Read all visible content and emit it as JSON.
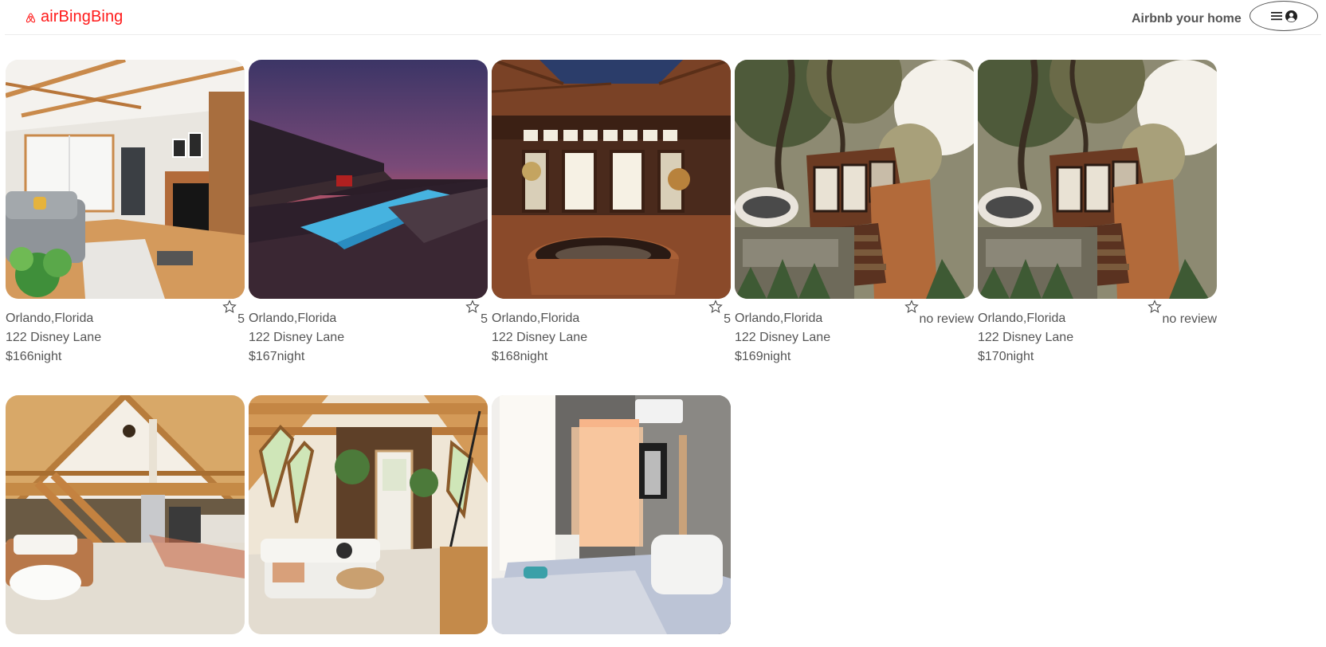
{
  "header": {
    "logo_text": "airBingBing",
    "host_link": "Airbnb your home",
    "brand_color": "#ff1a1a"
  },
  "listings": [
    {
      "location": "Orlando,Florida",
      "address": "122 Disney Lane",
      "price": "$166night",
      "rating": "5",
      "photo": "living-room-fireplace"
    },
    {
      "location": "Orlando,Florida",
      "address": "122 Disney Lane",
      "price": "$167night",
      "rating": "5",
      "photo": "infinity-pool-sunset"
    },
    {
      "location": "Orlando,Florida",
      "address": "122 Disney Lane",
      "price": "$168night",
      "rating": "5",
      "photo": "wooden-hot-tub-room"
    },
    {
      "location": "Orlando,Florida",
      "address": "122 Disney Lane",
      "price": "$169night",
      "rating": "no review",
      "photo": "cabin-under-trees"
    },
    {
      "location": "Orlando,Florida",
      "address": "122 Disney Lane",
      "price": "$170night",
      "rating": "no review",
      "photo": "cabin-under-trees"
    },
    {
      "location": "",
      "address": "",
      "price": "",
      "rating": "",
      "photo": "a-frame-loft-kitchen"
    },
    {
      "location": "",
      "address": "",
      "price": "",
      "rating": "",
      "photo": "a-frame-living-room"
    },
    {
      "location": "",
      "address": "",
      "price": "",
      "rating": "",
      "photo": "bedroom-orange-curtains"
    }
  ]
}
